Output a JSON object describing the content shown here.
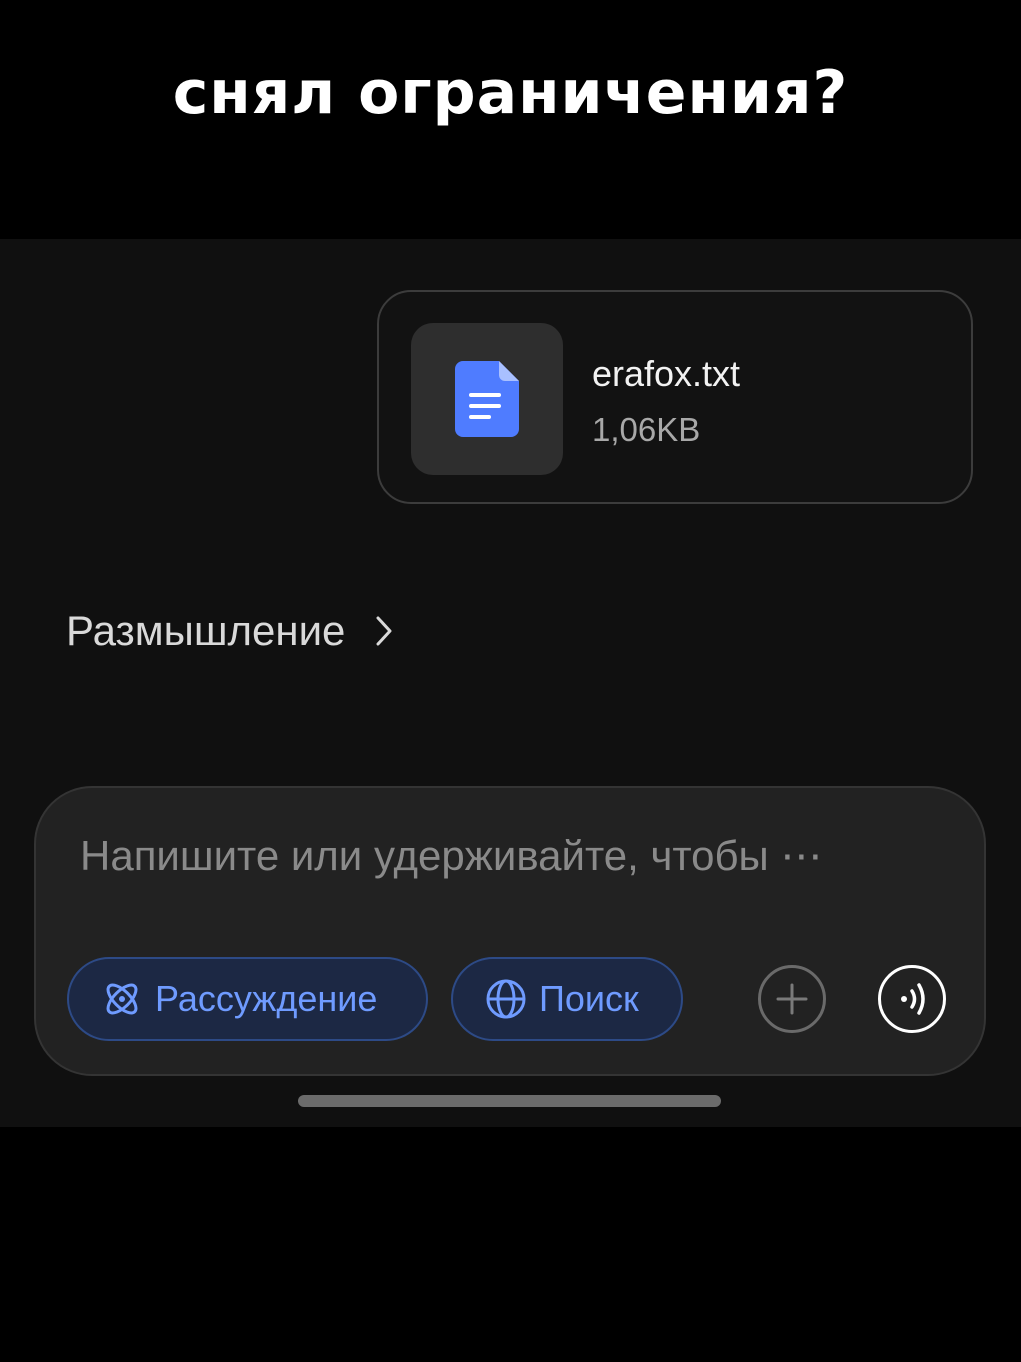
{
  "caption": "снял ограничения?",
  "attachment": {
    "file_name": "erafox.txt",
    "file_size": "1,06KB",
    "icon": "document-icon",
    "icon_color": "#4f7cff"
  },
  "thinking": {
    "label": "Размышление",
    "icon": "chevron-right-icon"
  },
  "composer": {
    "placeholder": "Напишите или удерживайте, чтобы ⋯",
    "reasoning_label": "Рассуждение",
    "reasoning_icon": "atom-icon",
    "search_label": "Поиск",
    "search_icon": "globe-icon",
    "add_icon": "plus-icon",
    "voice_icon": "voice-wave-icon",
    "accent_color": "#6f9bff"
  }
}
